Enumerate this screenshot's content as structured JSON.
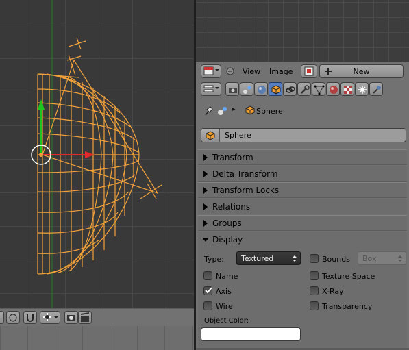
{
  "image_editor": {
    "menu_view": "View",
    "menu_image": "Image",
    "new_button": "New"
  },
  "properties": {
    "context_object": "Sphere",
    "object_name": "Sphere",
    "panels": {
      "transform": "Transform",
      "delta_transform": "Delta Transform",
      "transform_locks": "Transform Locks",
      "relations": "Relations",
      "groups": "Groups",
      "display": "Display"
    },
    "display": {
      "type_label": "Type:",
      "type_value": "Textured",
      "bounds_label": "Bounds",
      "bounds_value": "Box",
      "name_label": "Name",
      "texture_space_label": "Texture Space",
      "axis_label": "Axis",
      "xray_label": "X-Ray",
      "wire_label": "Wire",
      "transparency_label": "Transparency",
      "object_color_label": "Object Color:",
      "object_color": "#ffffff",
      "checks": {
        "name": false,
        "texture_space": false,
        "axis": true,
        "xray": false,
        "wire": false,
        "transparency": false,
        "bounds": false
      }
    }
  },
  "viewport": {
    "wire_color": "#f0a030",
    "axis_x_color": "#e03030",
    "axis_y_color": "#28c028"
  }
}
